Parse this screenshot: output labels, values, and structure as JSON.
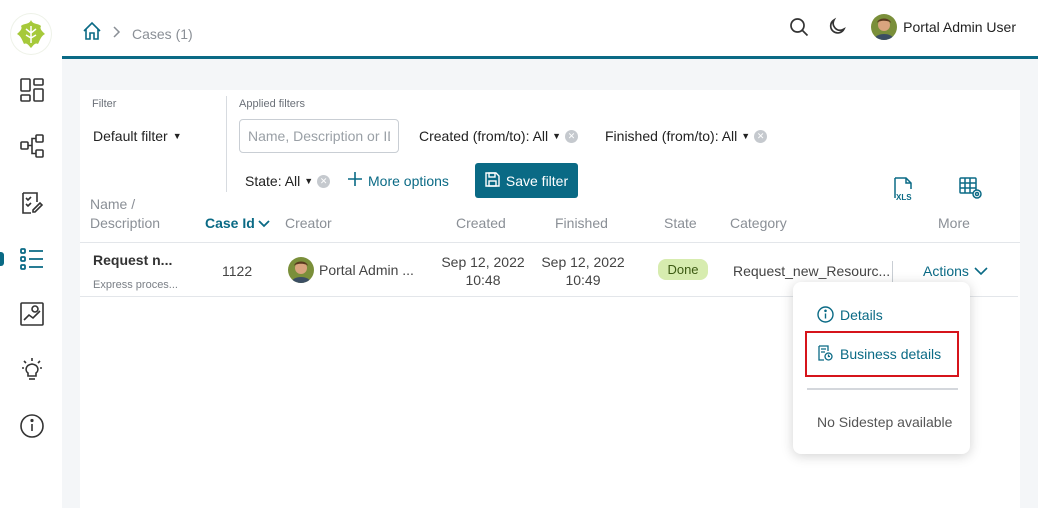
{
  "app": {
    "accent_color": "#0a6a85",
    "logo_icon": "ivy-leaf-logo"
  },
  "sidebar": {
    "items": [
      {
        "name": "dashboard-icon"
      },
      {
        "name": "process-icon"
      },
      {
        "name": "tasks-icon"
      },
      {
        "name": "cases-icon",
        "active": true
      },
      {
        "name": "statistics-icon"
      },
      {
        "name": "ideas-icon"
      },
      {
        "name": "info-icon"
      }
    ]
  },
  "topbar": {
    "breadcrumb_current": "Cases (1)",
    "user_name": "Portal Admin User"
  },
  "filters": {
    "filter_label": "Filter",
    "filter_value": "Default filter",
    "applied_label": "Applied filters",
    "search_placeholder": "Name, Description or ID",
    "created_chip": "Created (from/to): All",
    "finished_chip": "Finished (from/to): All",
    "state_chip": "State: All",
    "more_options": "More options",
    "save_filter": "Save filter"
  },
  "table": {
    "columns": {
      "name": "Name /",
      "name_line2": "Description",
      "case_id": "Case Id",
      "creator": "Creator",
      "created": "Created",
      "finished": "Finished",
      "state": "State",
      "category": "Category",
      "more": "More"
    },
    "rows": [
      {
        "name": "Request n...",
        "description": "Express proces...",
        "case_id": "1122",
        "creator": "Portal Admin ...",
        "created_date": "Sep 12, 2022",
        "created_time": "10:48",
        "finished_date": "Sep 12, 2022",
        "finished_time": "10:49",
        "state": "Done",
        "category": "Request_new_Resourc...",
        "actions": "Actions"
      }
    ]
  },
  "actions_menu": {
    "details": "Details",
    "business_details": "Business details",
    "no_sidestep": "No Sidestep available"
  }
}
